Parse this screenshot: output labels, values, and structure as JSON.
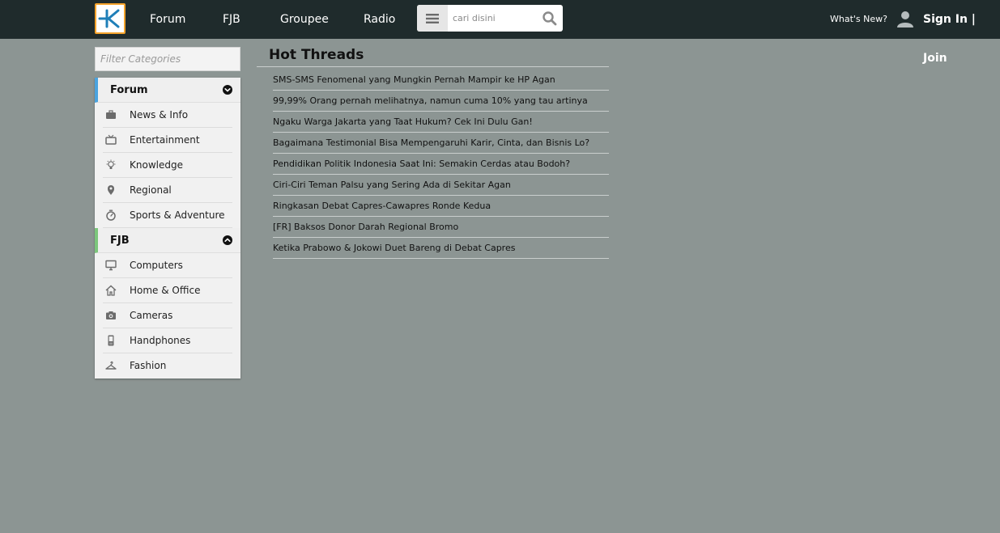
{
  "header": {
    "nav": [
      "Forum",
      "FJB",
      "Groupee",
      "Radio"
    ],
    "search_placeholder": "cari disini",
    "whats_new": "What's New?",
    "sign_in": "Sign In",
    "separator": "|",
    "join": "Join",
    "brand_color": "#f5a32b",
    "logo_icon": "kaskus-logo-icon",
    "menu_icon": "hamburger-icon",
    "search_icon": "search-icon",
    "user_icon": "user-icon"
  },
  "sidebar": {
    "filter_placeholder": "Filter Categories",
    "groups": [
      {
        "label": "Forum",
        "accent": "#4aa3df",
        "toggle_icon": "chevron-down-icon",
        "items": [
          {
            "label": "News & Info",
            "icon": "briefcase-icon"
          },
          {
            "label": "Entertainment",
            "icon": "tv-icon"
          },
          {
            "label": "Knowledge",
            "icon": "lightbulb-icon"
          },
          {
            "label": "Regional",
            "icon": "map-pin-icon"
          },
          {
            "label": "Sports & Adventure",
            "icon": "stopwatch-icon"
          }
        ]
      },
      {
        "label": "FJB",
        "accent": "#7cc67c",
        "toggle_icon": "chevron-up-icon",
        "items": [
          {
            "label": "Computers",
            "icon": "monitor-icon"
          },
          {
            "label": "Home & Office",
            "icon": "home-icon"
          },
          {
            "label": "Cameras",
            "icon": "camera-icon"
          },
          {
            "label": "Handphones",
            "icon": "phone-icon"
          },
          {
            "label": "Fashion",
            "icon": "hanger-icon"
          }
        ]
      }
    ]
  },
  "hot_threads": {
    "title": "Hot Threads",
    "items": [
      "SMS-SMS Fenomenal yang Mungkin Pernah Mampir ke HP Agan",
      "99,99% Orang pernah melihatnya, namun cuma 10% yang tau artinya",
      "Ngaku Warga Jakarta yang Taat Hukum? Cek Ini Dulu Gan!",
      "Bagaimana Testimonial Bisa Mempengaruhi Karir, Cinta, dan Bisnis Lo?",
      "Pendidikan Politik Indonesia Saat Ini: Semakin Cerdas atau Bodoh?",
      "Ciri-Ciri Teman Palsu yang Sering Ada di Sekitar Agan",
      "Ringkasan Debat Capres-Cawapres Ronde Kedua",
      "[FR] Baksos Donor Darah Regional Bromo",
      "Ketika Prabowo & Jokowi Duet Bareng di Debat Capres"
    ]
  }
}
